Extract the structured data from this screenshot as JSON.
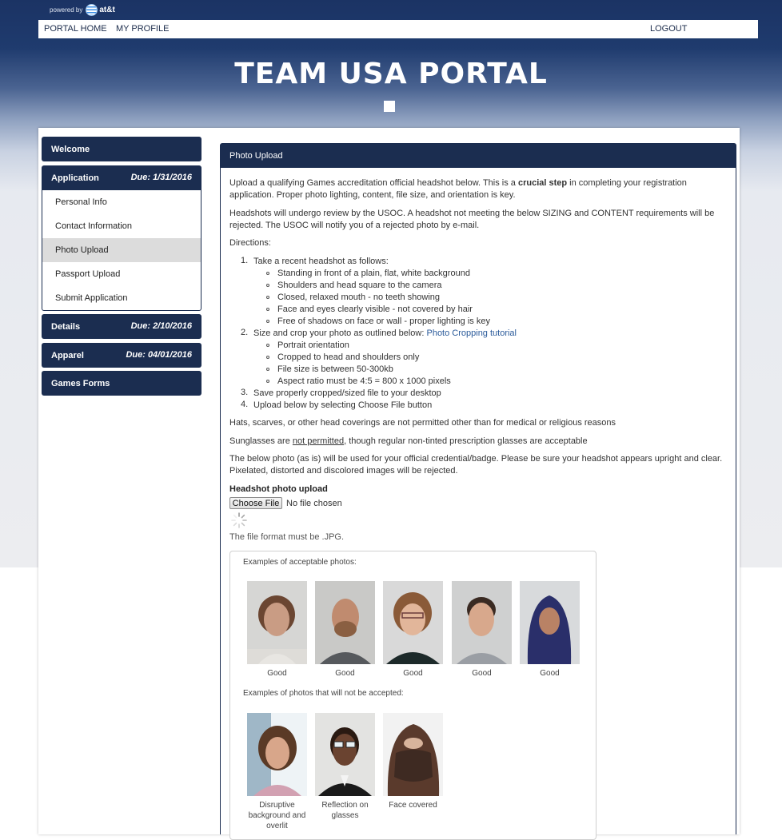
{
  "header": {
    "powered_by": "powered by",
    "brand": "at&t",
    "nav": {
      "home": "PORTAL HOME",
      "profile": "MY PROFILE",
      "logout": "LOGOUT"
    },
    "title": "TEAM USA PORTAL"
  },
  "sidebar": {
    "welcome": "Welcome",
    "application": {
      "label": "Application",
      "due": "Due: 1/31/2016"
    },
    "items": [
      "Personal Info",
      "Contact Information",
      "Photo Upload",
      "Passport Upload",
      "Submit Application"
    ],
    "active_item": "Photo Upload",
    "details": {
      "label": "Details",
      "due": "Due: 2/10/2016"
    },
    "apparel": {
      "label": "Apparel",
      "due": "Due: 04/01/2016"
    },
    "games_forms": "Games Forms"
  },
  "content": {
    "heading": "Photo Upload",
    "intro_a": "Upload a qualifying Games accreditation official headshot below. This is a ",
    "intro_bold": "crucial step",
    "intro_b": " in completing your registration application. Proper photo lighting, content, file size, and orientation is key.",
    "review": "Headshots will undergo review by the USOC. A headshot not meeting the below SIZING and CONTENT requirements will be rejected. The USOC will notify you of a rejected photo by e-mail.",
    "directions": "Directions:",
    "step1": "Take a recent headshot as follows:",
    "step1_items": [
      "Standing in front of a plain, flat, white background",
      "Shoulders and head square to the camera",
      "Closed, relaxed mouth - no teeth showing",
      "Face and eyes clearly visible - not covered by hair",
      "Free of shadows on face or wall - proper lighting is key"
    ],
    "step2": "Size and crop your photo as outlined below: ",
    "step2_link": "Photo Cropping tutorial",
    "step2_items": [
      "Portrait orientation",
      "Cropped to head and shoulders only",
      "File size is between 50-300kb",
      "Aspect ratio must be 4:5 = 800 x 1000 pixels"
    ],
    "step3": "Save properly cropped/sized file to your desktop",
    "step4": "Upload below by selecting Choose File button",
    "hats": "Hats, scarves, or other head coverings are not permitted other than for medical or religious reasons",
    "sunglasses_a": "Sunglasses are ",
    "sunglasses_u": "not permitted",
    "sunglasses_b": ", though regular non-tinted prescription glasses are acceptable",
    "credential": "The below photo (as is) will be used for your official credential/badge. Please be sure your headshot appears upright and clear. Pixelated, distorted and discolored images will be rejected.",
    "upload_label": "Headshot photo upload",
    "choose_file": "Choose File",
    "no_file": "No file chosen",
    "format": "The file format must be .JPG.",
    "examples": {
      "acceptable_caption": "Examples of acceptable photos:",
      "acceptable_labels": [
        "Good",
        "Good",
        "Good",
        "Good",
        "Good"
      ],
      "rejected_caption": "Examples of photos that will not be accepted:",
      "rejected_labels": [
        "Disruptive background and overlit",
        "Reflection on glasses",
        "Face covered"
      ]
    }
  },
  "colors": {
    "navy": "#1b2d50",
    "active_item": "#dcdcdc",
    "link": "#2a5a9a"
  }
}
